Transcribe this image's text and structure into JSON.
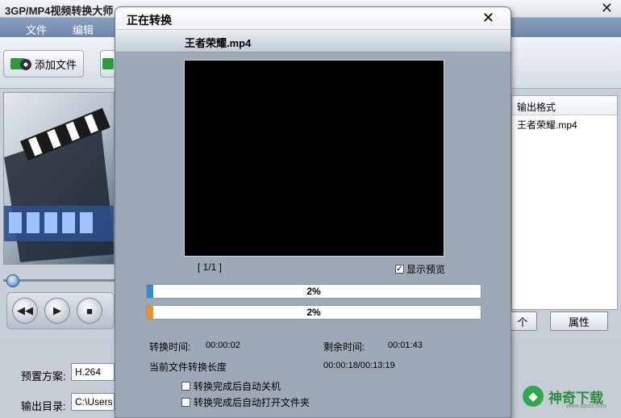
{
  "main": {
    "title": "3GP/MP4视频转换大师",
    "close_glyph": "✕",
    "menu": [
      "文件",
      "编辑"
    ],
    "toolbar": {
      "add_file_label": "添加文件"
    },
    "player": {
      "rewind": "◀◀",
      "play": "▶",
      "stop": "■"
    },
    "list": {
      "header": "输出格式",
      "rows": [
        "王者荣耀.mp4"
      ]
    },
    "buttons": {
      "partial": "个",
      "properties": "属性"
    },
    "preset_label": "预置方案:",
    "preset_value": "H.264",
    "output_dir_label": "输出目录:",
    "output_dir_value": "C:\\Users"
  },
  "dialog": {
    "title": "正在转换",
    "close_glyph": "✕",
    "filename": "王者荣耀.mp4",
    "page_counter": "[ 1/1 ]",
    "show_preview_label": "显示预览",
    "show_preview_checked": true,
    "progress_file": {
      "percent": 2,
      "label": "2%",
      "color": "#2f8fd0"
    },
    "progress_total": {
      "percent": 2,
      "label": "2%",
      "color": "#f0902a"
    },
    "elapsed_label": "转换时间:",
    "elapsed_value": "00:00:02",
    "remaining_label": "剩余时间:",
    "remaining_value": "00:01:43",
    "length_label": "当前文件转换长度",
    "length_value": "00:00:18/00:13:19",
    "option_shutdown": "转换完成后自动关机",
    "option_open_folder": "转换完成后自动打开文件夹"
  },
  "watermark": {
    "logo_char": "◆",
    "text": "神奇下载",
    "url": "www.sqxzz.com"
  }
}
